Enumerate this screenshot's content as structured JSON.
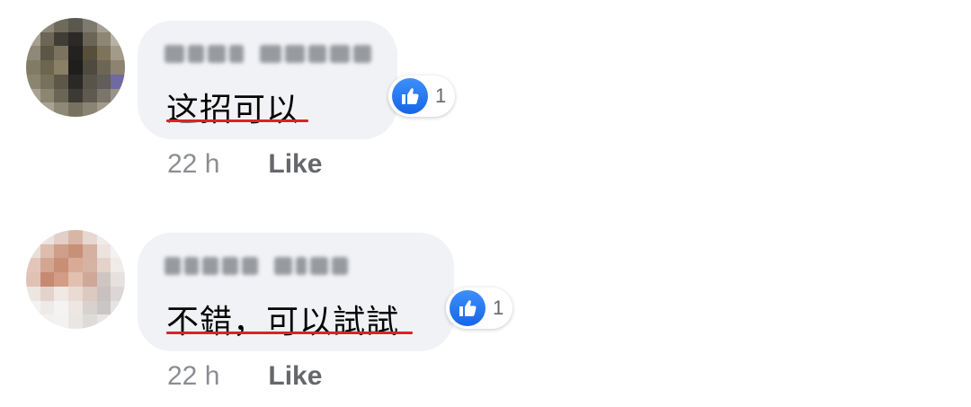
{
  "comments": [
    {
      "text": "这招可以",
      "reaction_count": "1",
      "time": "22 h",
      "like_label": "Like"
    },
    {
      "text": "不錯，可以試試",
      "reaction_count": "1",
      "time": "22 h",
      "like_label": "Like"
    }
  ],
  "colors": {
    "bubble": "#f0f2f5",
    "like_blue": "#1877f2",
    "meta_gray": "#65676b",
    "underline_red": "#d9222c"
  },
  "icons": {
    "reaction": "thumbs-up-icon"
  }
}
